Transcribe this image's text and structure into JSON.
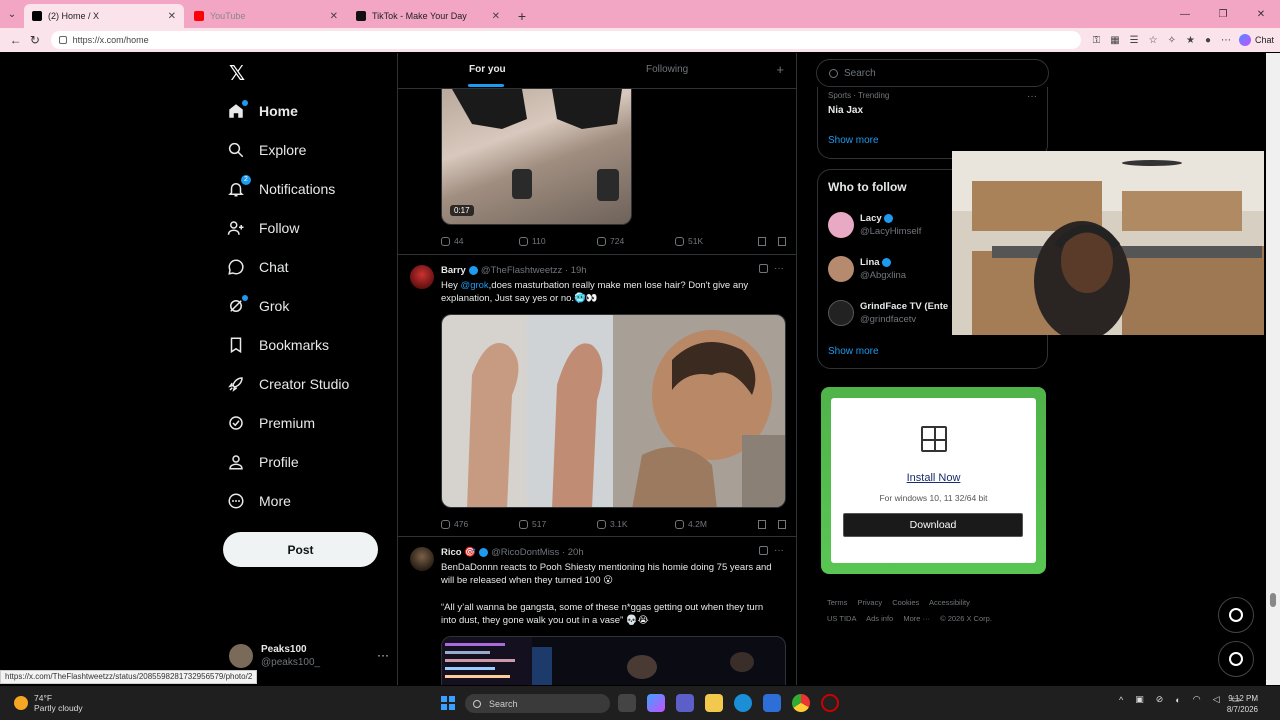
{
  "browser": {
    "tabs": [
      {
        "title": "(2) Home / X",
        "active": true
      },
      {
        "title": "YouTube",
        "active": false
      },
      {
        "title": "TikTok - Make Your Day",
        "active": false
      }
    ],
    "url": "https://x.com/home",
    "chat_label": "Chat",
    "status_url": "https://x.com/TheFlashtweetzz/status/2085598281732956579/photo/2"
  },
  "nav": {
    "items": [
      {
        "label": "Home",
        "icon": "home-icon"
      },
      {
        "label": "Explore",
        "icon": "search-icon"
      },
      {
        "label": "Notifications",
        "icon": "bell-icon",
        "badge": "2"
      },
      {
        "label": "Follow",
        "icon": "add-user-icon"
      },
      {
        "label": "Chat",
        "icon": "chat-icon"
      },
      {
        "label": "Grok",
        "icon": "grok-icon"
      },
      {
        "label": "Bookmarks",
        "icon": "bookmark-icon"
      },
      {
        "label": "Creator Studio",
        "icon": "rocket-icon"
      },
      {
        "label": "Premium",
        "icon": "verified-icon"
      },
      {
        "label": "Profile",
        "icon": "person-icon"
      },
      {
        "label": "More",
        "icon": "more-icon"
      }
    ],
    "post_label": "Post",
    "account": {
      "name": "Peaks100",
      "handle": "@peaks100_"
    }
  },
  "feed": {
    "tabs": [
      "For you",
      "Following"
    ],
    "tweets": [
      {
        "duration": "0:17",
        "replies": "44",
        "reposts": "110",
        "likes": "724",
        "views": "51K"
      },
      {
        "name": "Barry",
        "handle": "@TheFlashtweetzz",
        "time": "19h",
        "text_pre": "Hey ",
        "mention": "@grok",
        "text_post": ",does masturbation really make men lose hair? Don't give any explanation, Just say yes or no.🥶👀",
        "replies": "476",
        "reposts": "517",
        "likes": "3.1K",
        "views": "4.2M"
      },
      {
        "name": "Rico 🎯",
        "handle": "@RicoDontMiss",
        "time": "20h",
        "text": "BenDaDonnn reacts to Pooh Shiesty mentioning his homie doing 75 years and will be released when they turned 100 😮",
        "text2": "“All y’all wanna be gangsta, some of these n*ggas getting out when they turn into dust, they gone walk you out in a vase” 💀😭"
      }
    ]
  },
  "right": {
    "search_placeholder": "Search",
    "trend": {
      "category": "Sports · Trending",
      "name": "Nia Jax"
    },
    "show_more": "Show more",
    "who_to_follow": "Who to follow",
    "follows": [
      {
        "name": "Lacy",
        "handle": "@LacyHimself"
      },
      {
        "name": "Lina",
        "handle": "@Abgxlina"
      },
      {
        "name": "GrindFace TV (Ente",
        "handle": "@grindfacetv"
      }
    ],
    "ad": {
      "install": "Install Now",
      "sub": "For windows 10, 11 32/64 bit",
      "download": "Download"
    },
    "footer": [
      "Terms",
      "Privacy",
      "Cookies",
      "Accessibility",
      "US TIDA",
      "Ads info",
      "More ···",
      "© 2026 X Corp."
    ]
  },
  "taskbar": {
    "temp": "74°F",
    "weather": "Partly cloudy",
    "search": "Search",
    "time": "9:12 PM",
    "date": "8/7/2026"
  }
}
